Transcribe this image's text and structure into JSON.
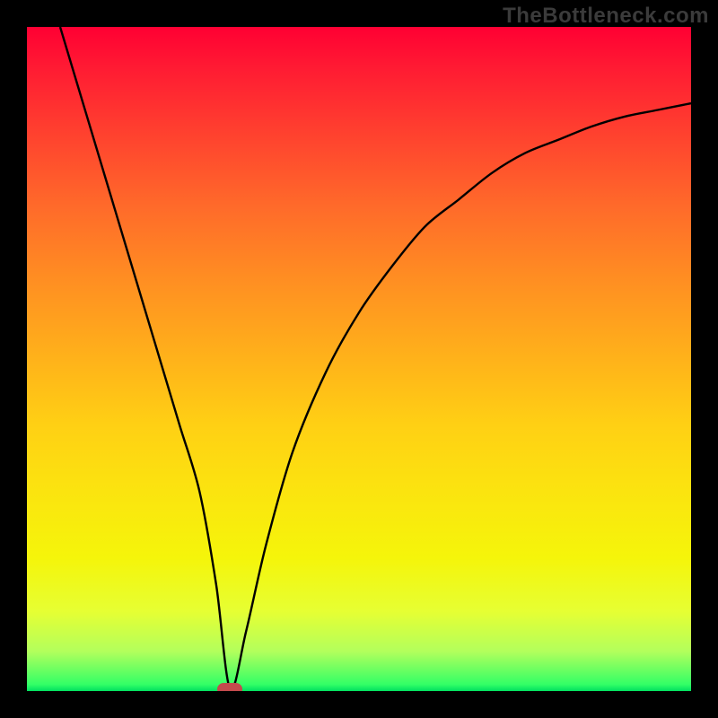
{
  "watermark": "TheBottleneck.com",
  "chart_data": {
    "type": "line",
    "title": "",
    "xlabel": "",
    "ylabel": "",
    "xlim": [
      0,
      100
    ],
    "ylim": [
      0,
      100
    ],
    "grid": false,
    "legend": false,
    "background": "gradient red-yellow-green (top to bottom)",
    "series": [
      {
        "name": "bottleneck-curve",
        "x": [
          5,
          8,
          11,
          14,
          17,
          20,
          23,
          26,
          28.5,
          30.6,
          33,
          36,
          40,
          45,
          50,
          55,
          60,
          65,
          70,
          75,
          80,
          85,
          90,
          95,
          100
        ],
        "y": [
          100,
          90,
          80,
          70,
          60,
          50,
          40,
          30,
          16,
          0.3,
          9,
          22,
          36,
          48,
          57,
          64,
          70,
          74,
          78,
          81,
          83,
          85,
          86.5,
          87.5,
          88.5
        ]
      }
    ],
    "marker": {
      "name": "minimum-marker",
      "x": 30.6,
      "y": 0.3,
      "color": "#c44a4d"
    }
  },
  "colors": {
    "curve": "#000000",
    "marker": "#c44a4d",
    "frame": "#000000"
  }
}
